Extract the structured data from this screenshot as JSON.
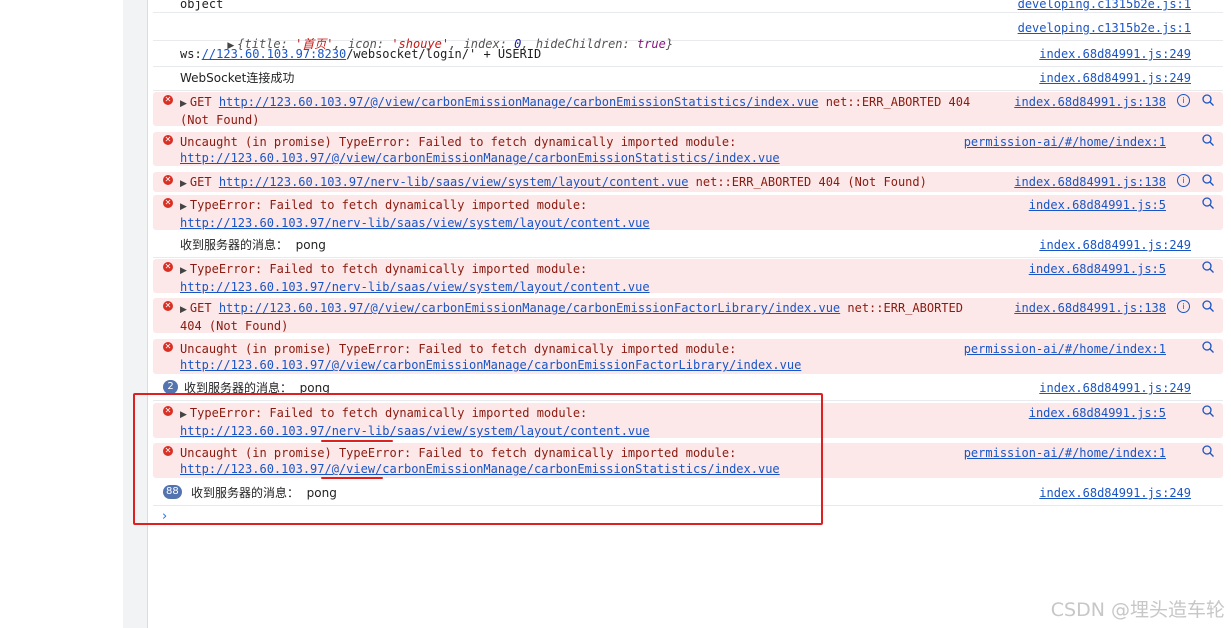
{
  "rows": {
    "r0": {
      "msg": "object",
      "src": "developing.c1315b2e.js:1"
    },
    "r1": {
      "prefix": "{title: ",
      "title_val": "'首页'",
      "sep1": ", icon: ",
      "icon_val": "'shouye'",
      "sep2": ", index: ",
      "index_val": "0",
      "sep3": ", hideChildren: ",
      "hide_val": "true",
      "suffix": "}",
      "src": "developing.c1315b2e.js:1"
    },
    "r2": {
      "prefix": "ws:",
      "link": "//123.60.103.97:8230",
      "suffix": "/websocket/login/' + USERID",
      "src": "index.68d84991.js:249"
    },
    "r3": {
      "msg": "WebSocket连接成功",
      "src": "index.68d84991.js:249"
    },
    "r4": {
      "method": "GET ",
      "link": "http://123.60.103.97/@/view/carbonEmissionManage/carbonEmissionStatistics/index.vue",
      "tail": " net::ERR_ABORTED 404",
      "line2": "(Not Found)",
      "src": "index.68d84991.js:138"
    },
    "r5": {
      "msg": "Uncaught (in promise) TypeError: Failed to fetch dynamically imported module:",
      "link": "http://123.60.103.97/@/view/carbonEmissionManage/carbonEmissionStatistics/index.vue",
      "src": "permission-ai/#/home/index:1"
    },
    "r6": {
      "method": "GET ",
      "link": "http://123.60.103.97/nerv-lib/saas/view/system/layout/content.vue",
      "tail": " net::ERR_ABORTED 404 (Not Found)",
      "src": "index.68d84991.js:138"
    },
    "r7": {
      "msg": "TypeError: Failed to fetch dynamically imported module:",
      "link": "http://123.60.103.97/nerv-lib/saas/view/system/layout/content.vue",
      "src": "index.68d84991.js:5"
    },
    "r8": {
      "msg": "收到服务器的消息：  pong",
      "src": "index.68d84991.js:249"
    },
    "r9": {
      "msg": "TypeError: Failed to fetch dynamically imported module:",
      "link": "http://123.60.103.97/nerv-lib/saas/view/system/layout/content.vue",
      "src": "index.68d84991.js:5"
    },
    "r10": {
      "method": "GET ",
      "link": "http://123.60.103.97/@/view/carbonEmissionManage/carbonEmissionFactorLibrary/index.vue",
      "tail": " net::ERR_ABORTED",
      "line2": "404 (Not Found)",
      "src": "index.68d84991.js:138"
    },
    "r11": {
      "msg": "Uncaught (in promise) TypeError: Failed to fetch dynamically imported module:",
      "link": "http://123.60.103.97/@/view/carbonEmissionManage/carbonEmissionFactorLibrary/index.vue",
      "src": "permission-ai/#/home/index:1"
    },
    "r12": {
      "count": "2",
      "msg": "收到服务器的消息：  pong",
      "src": "index.68d84991.js:249"
    },
    "r13": {
      "msg": "TypeError: Failed to fetch dynamically imported module:",
      "link": "http://123.60.103.97/nerv-lib/saas/view/system/layout/content.vue",
      "src": "index.68d84991.js:5"
    },
    "r14": {
      "msg": "Uncaught (in promise) TypeError: Failed to fetch dynamically imported module:",
      "link": "http://123.60.103.97/@/view/carbonEmissionManage/carbonEmissionStatistics/index.vue",
      "src": "permission-ai/#/home/index:1"
    },
    "r15": {
      "count": "88",
      "msg": "收到服务器的消息：  pong",
      "src": "index.68d84991.js:249"
    }
  },
  "icons": {
    "error": "error-circle-icon",
    "expand": "expand-triangle-icon",
    "info": "info-circle-icon",
    "search": "search-icon",
    "prompt": "prompt-chevron-icon"
  },
  "colors": {
    "error_bg": "#fce8e8",
    "error_text": "#8b1a10",
    "link": "#1a55c4",
    "annotation": "#e02020",
    "badge": "#5474b0"
  },
  "watermark": "CSDN @埋头造车轮"
}
